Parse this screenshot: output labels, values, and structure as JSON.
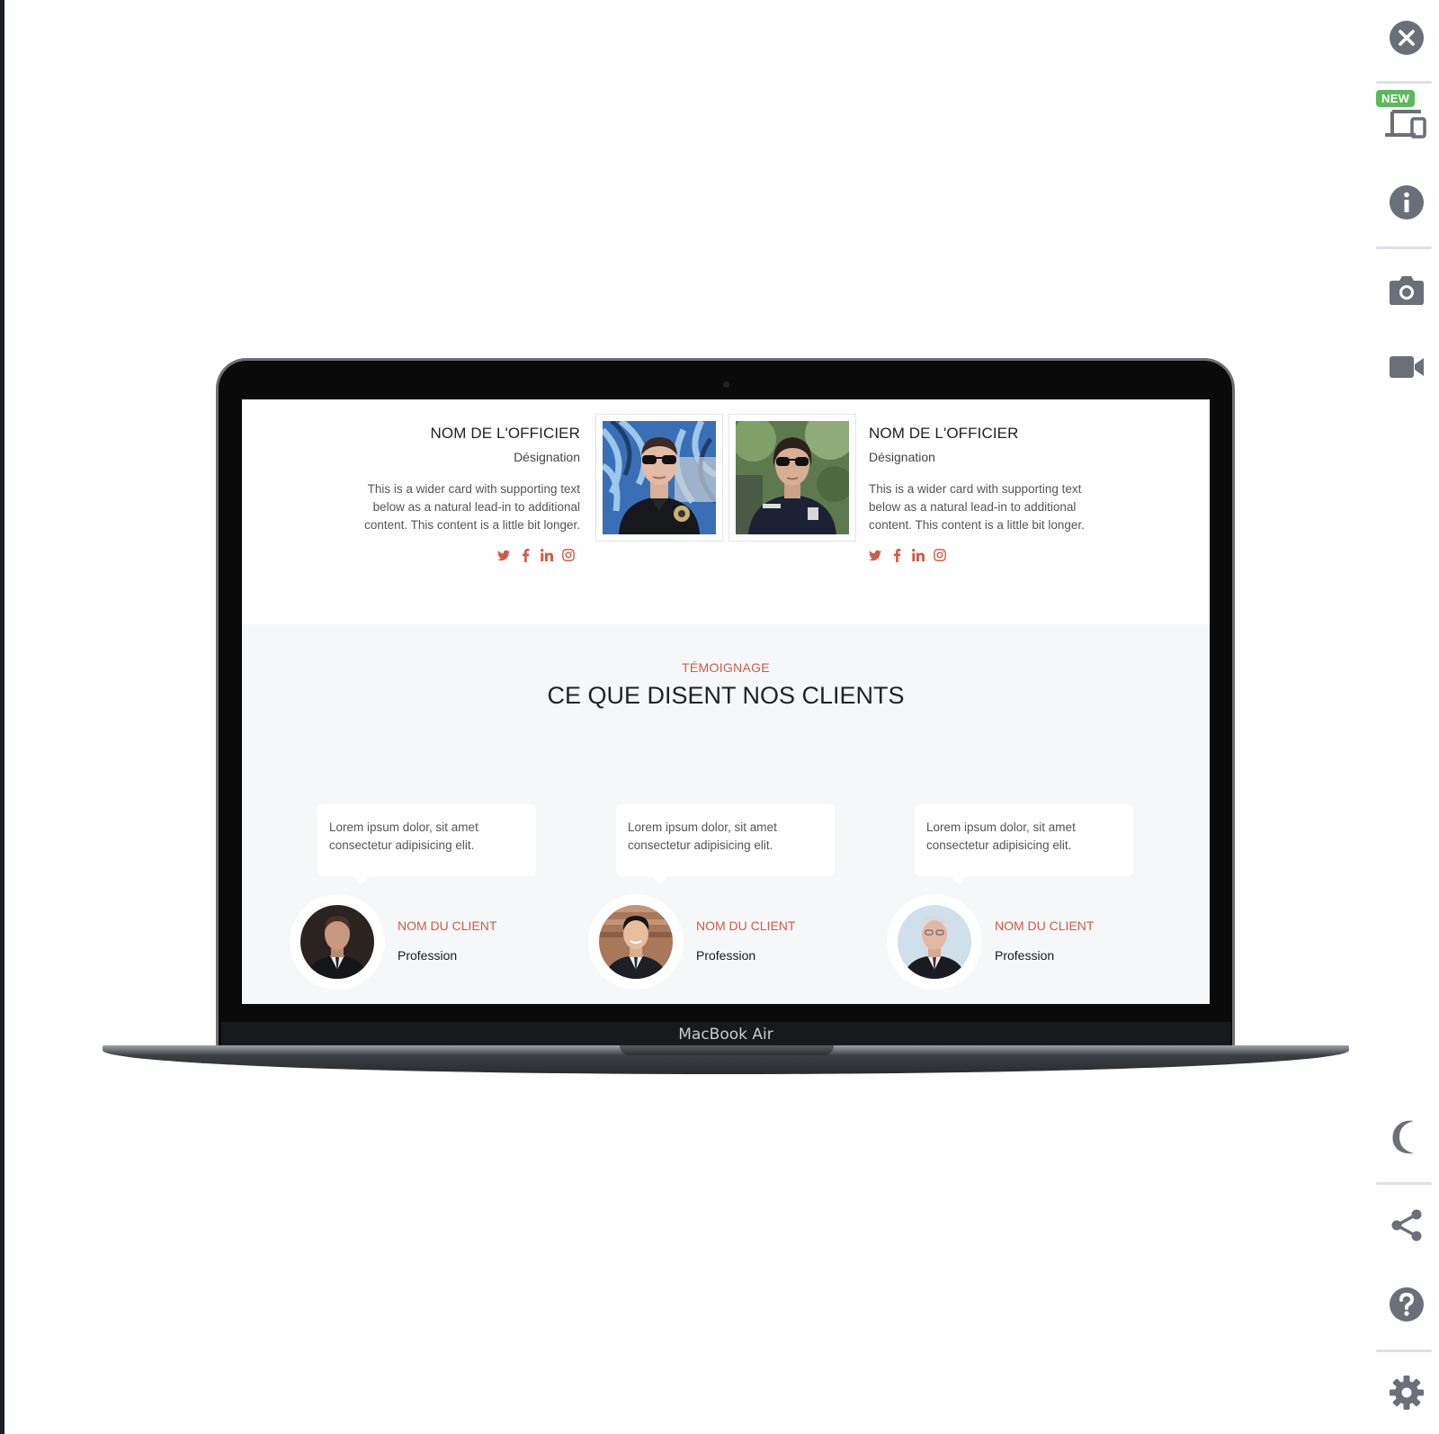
{
  "toolbar": {
    "new_badge": "NEW",
    "buttons": [
      "close-icon",
      "devices-icon",
      "info-icon",
      "camera-icon",
      "video-icon",
      "moon-icon",
      "share-icon",
      "help-icon",
      "gear-icon"
    ]
  },
  "device": {
    "label": "MacBook Air"
  },
  "team": {
    "officers": [
      {
        "name": "NOM DE L'OFFICIER",
        "designation": "Désignation",
        "description": "This is a wider card with supporting text below as a natural lead-in to additional content. This content is a little bit longer."
      },
      {
        "name": "NOM DE L'OFFICIER",
        "designation": "Désignation",
        "description": "This is a wider card with supporting text below as a natural lead-in to additional content. This content is a little bit longer."
      }
    ],
    "social_icons": [
      "twitter-icon",
      "facebook-icon",
      "linkedin-icon",
      "instagram-icon"
    ]
  },
  "testimonials": {
    "eyebrow": "TÉMOIGNAGE",
    "title": "CE QUE DISENT NOS CLIENTS",
    "items": [
      {
        "quote": "Lorem ipsum dolor, sit amet consectetur adipisicing elit.",
        "name": "NOM DU CLIENT",
        "profession": "Profession"
      },
      {
        "quote": "Lorem ipsum dolor, sit amet consectetur adipisicing elit.",
        "name": "NOM DU CLIENT",
        "profession": "Profession"
      },
      {
        "quote": "Lorem ipsum dolor, sit amet consectetur adipisicing elit.",
        "name": "NOM DU CLIENT",
        "profession": "Profession"
      }
    ]
  },
  "colors": {
    "accent": "#d45a45",
    "toolbar_icon": "#6b6f78",
    "badge": "#5cb85c",
    "section_bg": "#f6f7f9"
  }
}
